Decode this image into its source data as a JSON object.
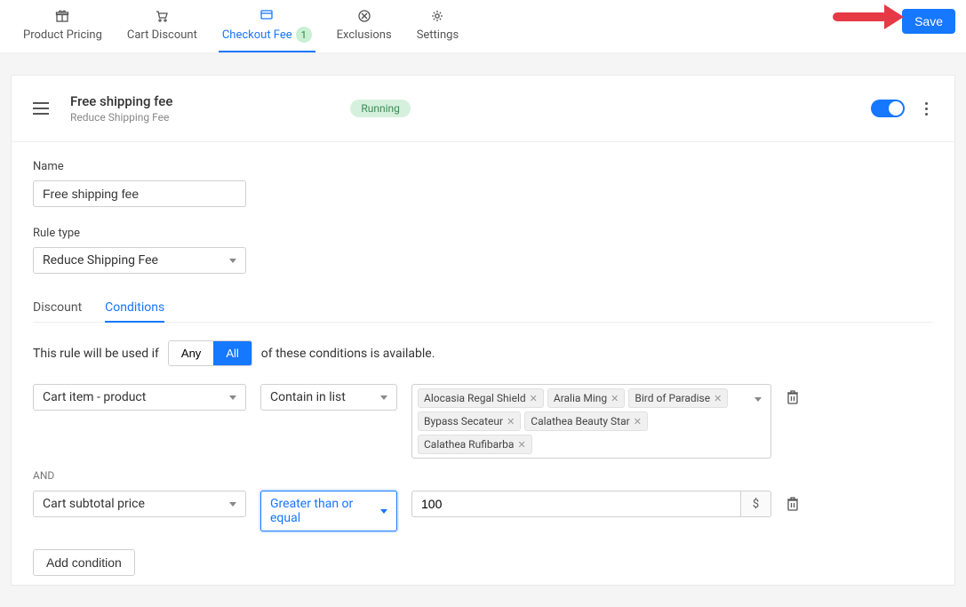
{
  "topbar": {
    "tabs": [
      {
        "label": "Product Pricing",
        "icon": "gift"
      },
      {
        "label": "Cart Discount",
        "icon": "cart"
      },
      {
        "label": "Checkout Fee",
        "icon": "card",
        "badge": "1",
        "active": true
      },
      {
        "label": "Exclusions",
        "icon": "forbid"
      },
      {
        "label": "Settings",
        "icon": "gear"
      }
    ],
    "save": "Save"
  },
  "rule": {
    "title": "Free shipping fee",
    "subtitle": "Reduce Shipping Fee",
    "status": "Running",
    "enabled": true
  },
  "form": {
    "name_label": "Name",
    "name_value": "Free shipping fee",
    "ruletype_label": "Rule type",
    "ruletype_value": "Reduce Shipping Fee"
  },
  "subtabs": [
    {
      "label": "Discount"
    },
    {
      "label": "Conditions",
      "active": true
    }
  ],
  "conditions": {
    "sentence_prefix": "This rule will be used if",
    "sentence_suffix": "of these conditions is available.",
    "any": "Any",
    "all": "All",
    "rows": [
      {
        "field": "Cart item - product",
        "operator": "Contain in list",
        "tags": [
          "Alocasia Regal Shield",
          "Aralia Ming",
          "Bird of Paradise",
          "Bypass Secateur",
          "Calathea Beauty Star",
          "Calathea Rufibarba"
        ]
      },
      {
        "field": "Cart subtotal price",
        "operator": "Greater than or equal",
        "value": "100",
        "addon": "$",
        "operator_focused": true
      }
    ],
    "and": "AND",
    "add": "Add condition"
  }
}
